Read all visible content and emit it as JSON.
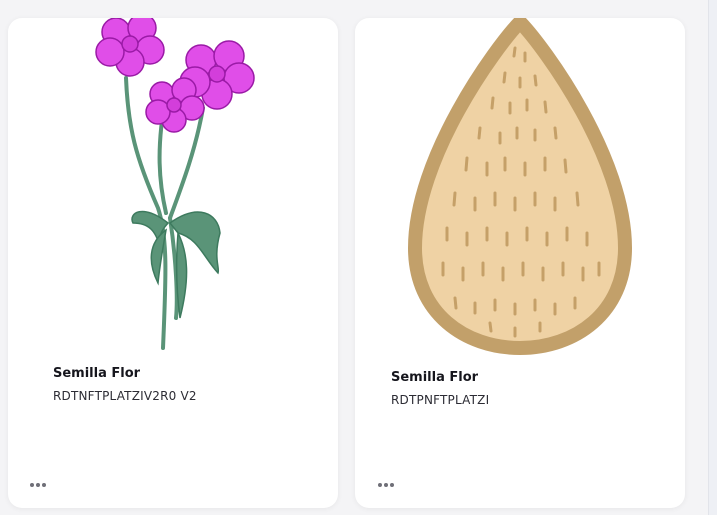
{
  "cards": [
    {
      "title": "Semilla Flor",
      "subtitle": "RDTNFTPLATZIV2R0 V2",
      "image_icon": "flower-illustration",
      "more_icon": "more-horizontal-icon"
    },
    {
      "title": "Semilla Flor",
      "subtitle": "RDTPNFTPLATZI",
      "image_icon": "seed-illustration",
      "more_icon": "more-horizontal-icon"
    }
  ],
  "colors": {
    "petal": "#e04ee8",
    "petal_outline": "#9a1aa6",
    "stem": "#5a9478",
    "seed_fill": "#efd2a4",
    "seed_outline": "#c2a06a",
    "seed_marks": "#c5a068"
  }
}
